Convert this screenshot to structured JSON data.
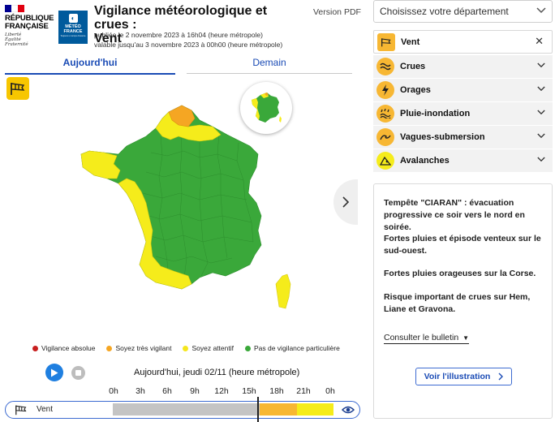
{
  "header": {
    "rf_title_lines": [
      "RÉPUBLIQUE",
      "FRANÇAISE"
    ],
    "rf_motto_lines": [
      "Liberté",
      "Égalité",
      "Fraternité"
    ],
    "mf_name_lines": [
      "MÉTÉO",
      "FRANCE"
    ],
    "mf_sub": "Toujours un temps d'avance",
    "title_line1": "Vigilance météorologique et crues :",
    "title_line2": "Vent",
    "published": "publiée le 2 novembre 2023 à 16h04 (heure métropole)",
    "valid_until": "valable jusqu'au 3 novembre 2023 à 00h00 (heure métropole)",
    "version_pdf": "Version PDF"
  },
  "tabs": {
    "today": "Aujourd'hui",
    "tomorrow": "Demain"
  },
  "legend": [
    {
      "label": "Vigilance absolue",
      "color": "#c81f1f"
    },
    {
      "label": "Soyez très vigilant",
      "color": "#f5a623"
    },
    {
      "label": "Soyez attentif",
      "color": "#f5e61d"
    },
    {
      "label": "Pas de vigilance particulière",
      "color": "#3aa83a"
    }
  ],
  "timeline": {
    "date_label": "Aujourd'hui, jeudi 02/11 (heure métropole)",
    "hours": [
      "0h",
      "3h",
      "6h",
      "9h",
      "12h",
      "15h",
      "18h",
      "21h",
      "0h"
    ],
    "row_label": "Vent",
    "segments": [
      {
        "from_hour": 0,
        "to_hour": 16,
        "color": "#c4c4c4"
      },
      {
        "from_hour": 16,
        "to_hour": 20,
        "color": "#f7b733"
      },
      {
        "from_hour": 20,
        "to_hour": 24,
        "color": "#f5ec1b"
      }
    ],
    "current_hour": 16
  },
  "department_select": {
    "placeholder": "Choisissez votre département"
  },
  "hazards": [
    {
      "label": "Vent",
      "icon": "wind-icon",
      "active": true,
      "color": "#f7b733"
    },
    {
      "label": "Crues",
      "icon": "flood-wave-icon",
      "active": false,
      "color": "#f7b733"
    },
    {
      "label": "Orages",
      "icon": "lightning-icon",
      "active": false,
      "color": "#f7b733"
    },
    {
      "label": "Pluie-inondation",
      "icon": "rain-flood-icon",
      "active": false,
      "color": "#f7b733"
    },
    {
      "label": "Vagues-submersion",
      "icon": "wave-submersion-icon",
      "active": false,
      "color": "#f7b733"
    },
    {
      "label": "Avalanches",
      "icon": "avalanche-icon",
      "active": false,
      "color": "#f5ec1b"
    }
  ],
  "info": {
    "paragraphs": [
      "Tempête \"CIARAN\" : évacuation progressive ce soir vers le nord en soirée.",
      "Fortes pluies et épisode venteux sur le sud-ouest.",
      "Fortes pluies orageuses sur la Corse.",
      "Risque important de crues sur Hem, Liane et Gravona."
    ],
    "bulletin_link": "Consulter le bulletin",
    "illustration_button": "Voir l'illustration"
  },
  "map_colors": {
    "green": "#3aa83a",
    "yellow": "#f5ec1b",
    "orange": "#f5a623"
  }
}
